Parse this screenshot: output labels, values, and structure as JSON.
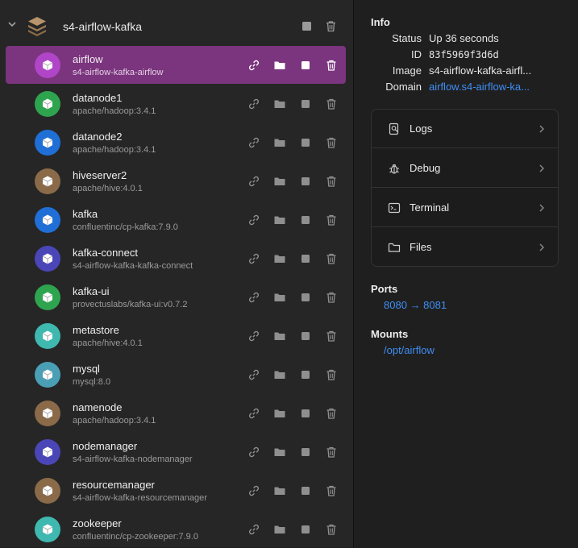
{
  "group": {
    "title": "s4-airflow-kafka"
  },
  "containers": [
    {
      "name": "airflow",
      "image": "s4-airflow-kafka-airflow",
      "color": "#b045c7",
      "selected": true
    },
    {
      "name": "datanode1",
      "image": "apache/hadoop:3.4.1",
      "color": "#2ea44f"
    },
    {
      "name": "datanode2",
      "image": "apache/hadoop:3.4.1",
      "color": "#1f6fd6"
    },
    {
      "name": "hiveserver2",
      "image": "apache/hive:4.0.1",
      "color": "#8a6a48"
    },
    {
      "name": "kafka",
      "image": "confluentinc/cp-kafka:7.9.0",
      "color": "#1f6fd6"
    },
    {
      "name": "kafka-connect",
      "image": "s4-airflow-kafka-kafka-connect",
      "color": "#4a46b8"
    },
    {
      "name": "kafka-ui",
      "image": "provectuslabs/kafka-ui:v0.7.2",
      "color": "#2ea44f"
    },
    {
      "name": "metastore",
      "image": "apache/hive:4.0.1",
      "color": "#3fb8b0"
    },
    {
      "name": "mysql",
      "image": "mysql:8.0",
      "color": "#4a9fb5"
    },
    {
      "name": "namenode",
      "image": "apache/hadoop:3.4.1",
      "color": "#8a6a48"
    },
    {
      "name": "nodemanager",
      "image": "s4-airflow-kafka-nodemanager",
      "color": "#4a46b8"
    },
    {
      "name": "resourcemanager",
      "image": "s4-airflow-kafka-resourcemanager",
      "color": "#8a6a48"
    },
    {
      "name": "zookeeper",
      "image": "confluentinc/cp-zookeeper:7.9.0",
      "color": "#3fb8b0"
    }
  ],
  "info": {
    "title": "Info",
    "status_label": "Status",
    "status": "Up 36 seconds",
    "id_label": "ID",
    "id": "83f5969f3d6d",
    "image_label": "Image",
    "image": "s4-airflow-kafka-airfl...",
    "domain_label": "Domain",
    "domain": "airflow.s4-airflow-ka..."
  },
  "actions": [
    {
      "label": "Logs",
      "icon": "logs-icon"
    },
    {
      "label": "Debug",
      "icon": "bug-icon"
    },
    {
      "label": "Terminal",
      "icon": "terminal-icon"
    },
    {
      "label": "Files",
      "icon": "folder-icon"
    }
  ],
  "ports": {
    "title": "Ports",
    "mapping": "8080 → 8081"
  },
  "mounts": {
    "title": "Mounts",
    "path": "/opt/airflow"
  },
  "colors": {
    "selected_row": "#7b347e",
    "link": "#3f8ef5"
  }
}
